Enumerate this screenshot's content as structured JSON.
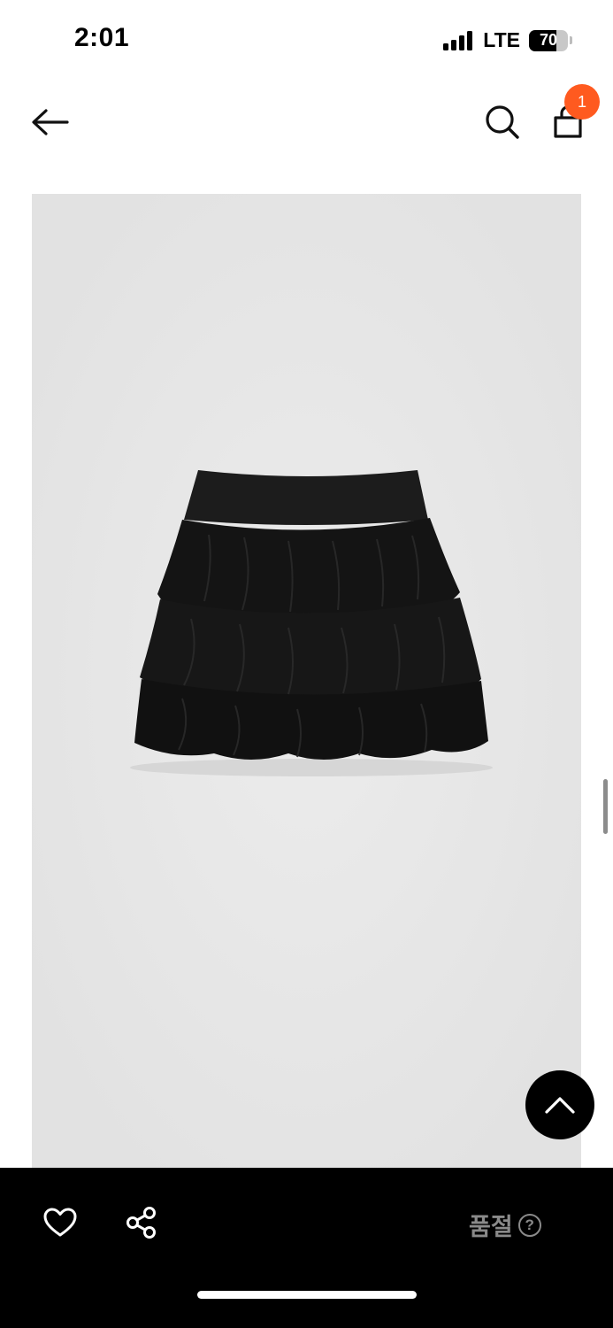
{
  "status_bar": {
    "time": "2:01",
    "network": "LTE",
    "battery_level": "70",
    "signal_bars": 4
  },
  "header": {
    "back_icon": "arrow-left-icon",
    "search_icon": "search-icon",
    "cart_icon": "shopping-bag-icon",
    "cart_count": "1"
  },
  "product": {
    "image_subject": "black tiered ruffle mini skirt",
    "image_background": "#e8e8e8",
    "garment_color": "#121212"
  },
  "floating": {
    "scroll_top_icon": "chevron-up-icon"
  },
  "bottom_bar": {
    "like_icon": "heart-icon",
    "share_icon": "share-icon",
    "status_label": "품절",
    "help_icon": "help-circle-icon",
    "help_glyph": "?"
  },
  "colors": {
    "badge": "#ff5a1f",
    "bottom_bar": "#000000",
    "status_label": "#8a8a8a"
  }
}
